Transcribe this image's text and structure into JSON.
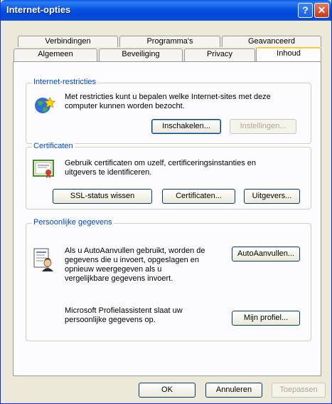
{
  "window": {
    "title": "Internet-opties"
  },
  "titlebar": {
    "help_label": "?",
    "close_label": "✕"
  },
  "tabs": {
    "row1": [
      "Verbindingen",
      "Programma's",
      "Geavanceerd"
    ],
    "row2": [
      "Algemeen",
      "Beveiliging",
      "Privacy",
      "Inhoud"
    ],
    "selected": "Inhoud"
  },
  "restrictions": {
    "legend": "Internet-restricties",
    "line1": "Met restricties kunt u bepalen welke Internet-sites met deze",
    "line2": "computer kunnen worden bezocht.",
    "enable_label": "Inschakelen...",
    "settings_label": "Instellingen..."
  },
  "certificates": {
    "legend": "Certificaten",
    "line1": "Gebruik certificaten om uzelf, certificeringsinstanties en",
    "line2": "uitgevers te identificeren.",
    "ssl_label": "SSL-status wissen",
    "certificates_label": "Certificaten...",
    "publishers_label": "Uitgevers..."
  },
  "personal": {
    "legend": "Persoonlijke gegevens",
    "autofill_lines": [
      "Als u AutoAanvullen gebruikt, worden de",
      "gegevens die u invoert, opgeslagen en",
      "opnieuw weergegeven als u",
      "vergelijkbare gegevens invoert."
    ],
    "autofill_label": "AutoAanvullen...",
    "profile_lines": [
      "Microsoft Profielassistent slaat uw",
      "persoonlijke gegevens op."
    ],
    "profile_label": "Mijn profiel..."
  },
  "footer": {
    "ok_label": "OK",
    "cancel_label": "Annuleren",
    "apply_label": "Toepassen"
  }
}
